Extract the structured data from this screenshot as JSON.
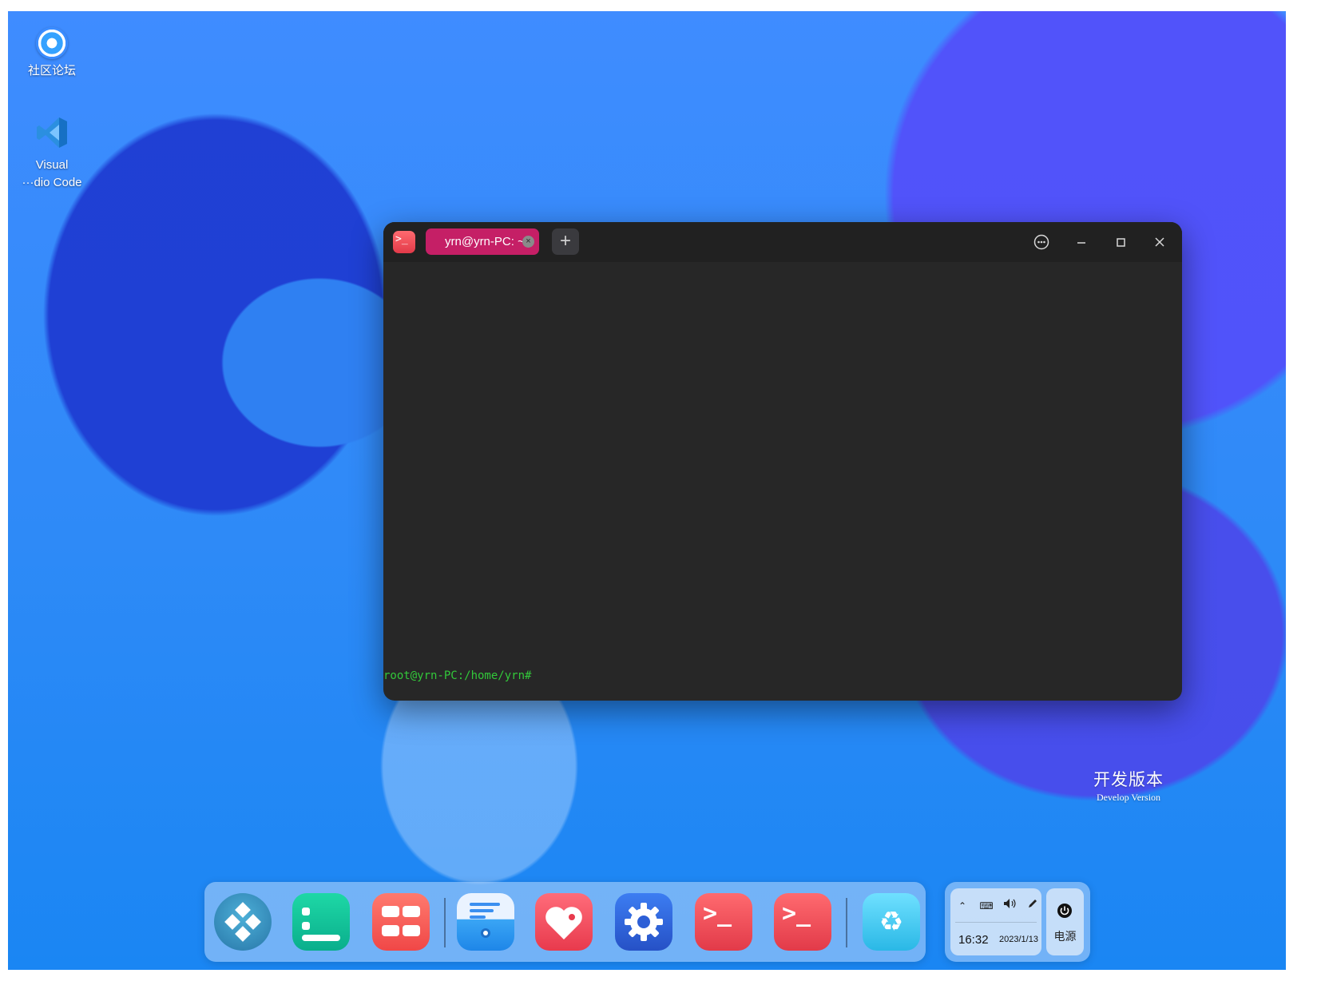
{
  "desktop": {
    "icons": [
      {
        "label": "社区论坛",
        "icon": "deepin-forum-icon"
      },
      {
        "label": "Visual\n···dio Code",
        "label_line1": "Visual",
        "label_line2": "···dio Code",
        "icon": "vscode-icon"
      }
    ],
    "watermark": {
      "cn": "开发版本",
      "en": "Develop Version"
    }
  },
  "terminal": {
    "tab_label": "yrn@yrn-PC: ~",
    "new_tab_symbol": "+",
    "prompt": "root@yrn-PC:/home/yrn#",
    "colors": {
      "tab": "#c51f66",
      "prompt": "#32c83a",
      "background": "#272727"
    }
  },
  "dock": {
    "items": [
      {
        "name": "launcher",
        "icon": "launcher-icon"
      },
      {
        "name": "multitasking",
        "icon": "multitask-icon"
      },
      {
        "name": "app-store",
        "icon": "app-store-icon"
      },
      {
        "name": "file-manager",
        "icon": "file-manager-icon"
      },
      {
        "name": "favorites",
        "icon": "favorite-tag-icon"
      },
      {
        "name": "control-center",
        "icon": "gear-icon"
      },
      {
        "name": "terminal",
        "icon": "terminal-icon"
      },
      {
        "name": "terminal",
        "icon": "terminal-icon"
      },
      {
        "name": "trash",
        "icon": "recycle-bin-icon"
      }
    ]
  },
  "tray": {
    "time": "16:32",
    "date": "2023/1/13",
    "power_label": "电源"
  }
}
